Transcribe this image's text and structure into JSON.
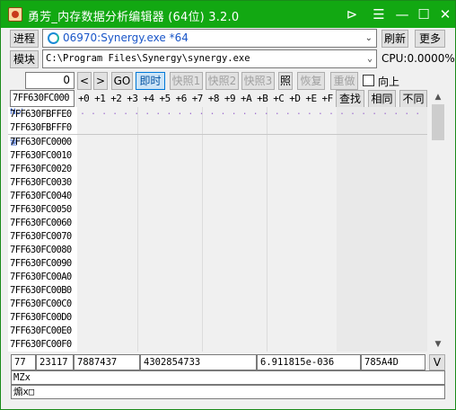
{
  "window": {
    "title": "勇芳_内存数据分析编辑器 (64位) 3.2.0",
    "pin_glyph": "⊳",
    "menu_glyph": "☰",
    "minimize_glyph": "—",
    "maximize_glyph": "☐",
    "close_glyph": "✕"
  },
  "toolbar1": {
    "process_label": "进程",
    "process_value": "06970:Synergy.exe *64",
    "refresh_label": "刷新",
    "more_label": "更多"
  },
  "toolbar2": {
    "module_label": "模块",
    "module_value": "C:\\Program Files\\Synergy\\synergy.exe",
    "cpu_text": "CPU:0.0000%"
  },
  "toolbar3": {
    "offset_value": "0",
    "prev_label": "<",
    "next_label": ">",
    "go_label": "GO",
    "realtime_label": "即时",
    "snap1_label": "快照1",
    "snap2_label": "快照2",
    "snap3_label": "快照3",
    "photo_label": "照",
    "restore_label": "恢复",
    "redo_label": "重做",
    "up_label": "向上"
  },
  "hex_header": {
    "address_input": "7FF630FC000",
    "columns": [
      "+0",
      "+1",
      "+2",
      "+3",
      "+4",
      "+5",
      "+6",
      "+7",
      "+8",
      "+9",
      "+A",
      "+B",
      "+C",
      "+D",
      "+E",
      "+F"
    ],
    "find_label": "查找",
    "same_label": "相同",
    "diff_label": "不同"
  },
  "rows": [
    {
      "addr": "7FF630FBFFE0",
      "marker": "No'",
      "dots": ". . . .  . . . . . . . . . . . . . . . . . . . . . . . . . . .   . . . . . . . . . . . . . . . ."
    },
    {
      "addr": "7FF630FBFFF0"
    },
    {
      "addr": "7FF630FC0000",
      "marker": "雷'"
    },
    {
      "addr": "7FF630FC0010"
    },
    {
      "addr": "7FF630FC0020"
    },
    {
      "addr": "7FF630FC0030"
    },
    {
      "addr": "7FF630FC0040"
    },
    {
      "addr": "7FF630FC0050"
    },
    {
      "addr": "7FF630FC0060"
    },
    {
      "addr": "7FF630FC0070"
    },
    {
      "addr": "7FF630FC0080"
    },
    {
      "addr": "7FF630FC0090"
    },
    {
      "addr": "7FF630FC00A0"
    },
    {
      "addr": "7FF630FC00B0"
    },
    {
      "addr": "7FF630FC00C0"
    },
    {
      "addr": "7FF630FC00D0"
    },
    {
      "addr": "7FF630FC00E0"
    },
    {
      "addr": "7FF630FC00F0"
    }
  ],
  "value_bar": {
    "byte": "77",
    "word": "23117",
    "dword": "7887437",
    "qword": "4302854733",
    "float": "6.911815e-036",
    "hex": "785A4D",
    "toggle_label": "V"
  },
  "info": {
    "line1": "MZx",
    "line2": "煽x□"
  }
}
